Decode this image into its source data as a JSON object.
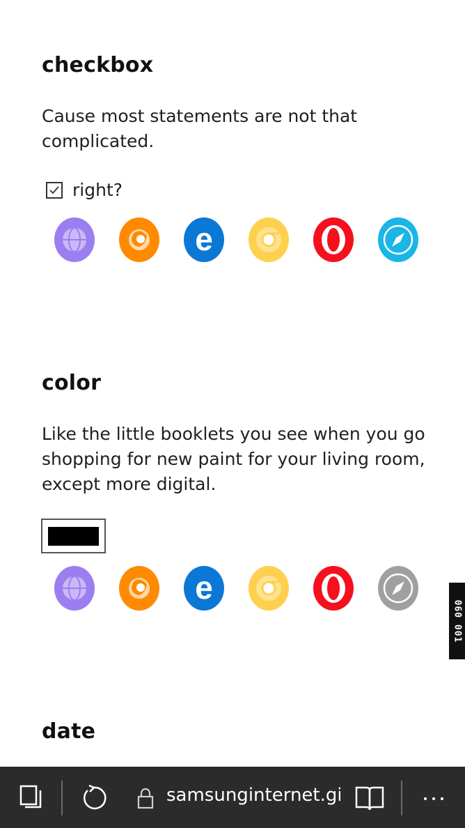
{
  "sections": {
    "checkbox": {
      "title": "checkbox",
      "description": "Cause most statements are not that complicated.",
      "check_label": "right?",
      "checked": true
    },
    "color": {
      "title": "color",
      "description": "Like the little booklets you see when you go shopping for new paint for your living room, except more digital.",
      "swatch_color": "#000000"
    },
    "date": {
      "title": "date"
    }
  },
  "browsers_row1": [
    {
      "name": "samsung-internet",
      "color": "#9C7EF0",
      "supported": true
    },
    {
      "name": "firefox",
      "color": "#FF8A00",
      "supported": true
    },
    {
      "name": "edge",
      "color": "#0C78D6",
      "supported": true
    },
    {
      "name": "chrome",
      "color": "#FFD04D",
      "supported": true
    },
    {
      "name": "opera",
      "color": "#F5101E",
      "supported": true
    },
    {
      "name": "safari",
      "color": "#1BB5E6",
      "supported": true
    }
  ],
  "browsers_row2": [
    {
      "name": "samsung-internet",
      "color": "#9C7EF0",
      "supported": true
    },
    {
      "name": "firefox",
      "color": "#FF8A00",
      "supported": true
    },
    {
      "name": "edge",
      "color": "#0C78D6",
      "supported": true
    },
    {
      "name": "chrome",
      "color": "#FFD04D",
      "supported": true
    },
    {
      "name": "opera",
      "color": "#F5101E",
      "supported": true
    },
    {
      "name": "safari",
      "color": "#A0A0A0",
      "supported": false
    }
  ],
  "side_tag": "060  001",
  "bottom_bar": {
    "url": "samsunginternet.gitl",
    "background": "#2b2b2b",
    "icons": [
      "tabs-icon",
      "reload-icon",
      "lock-icon",
      "reader-mode-icon",
      "more-icon"
    ]
  }
}
